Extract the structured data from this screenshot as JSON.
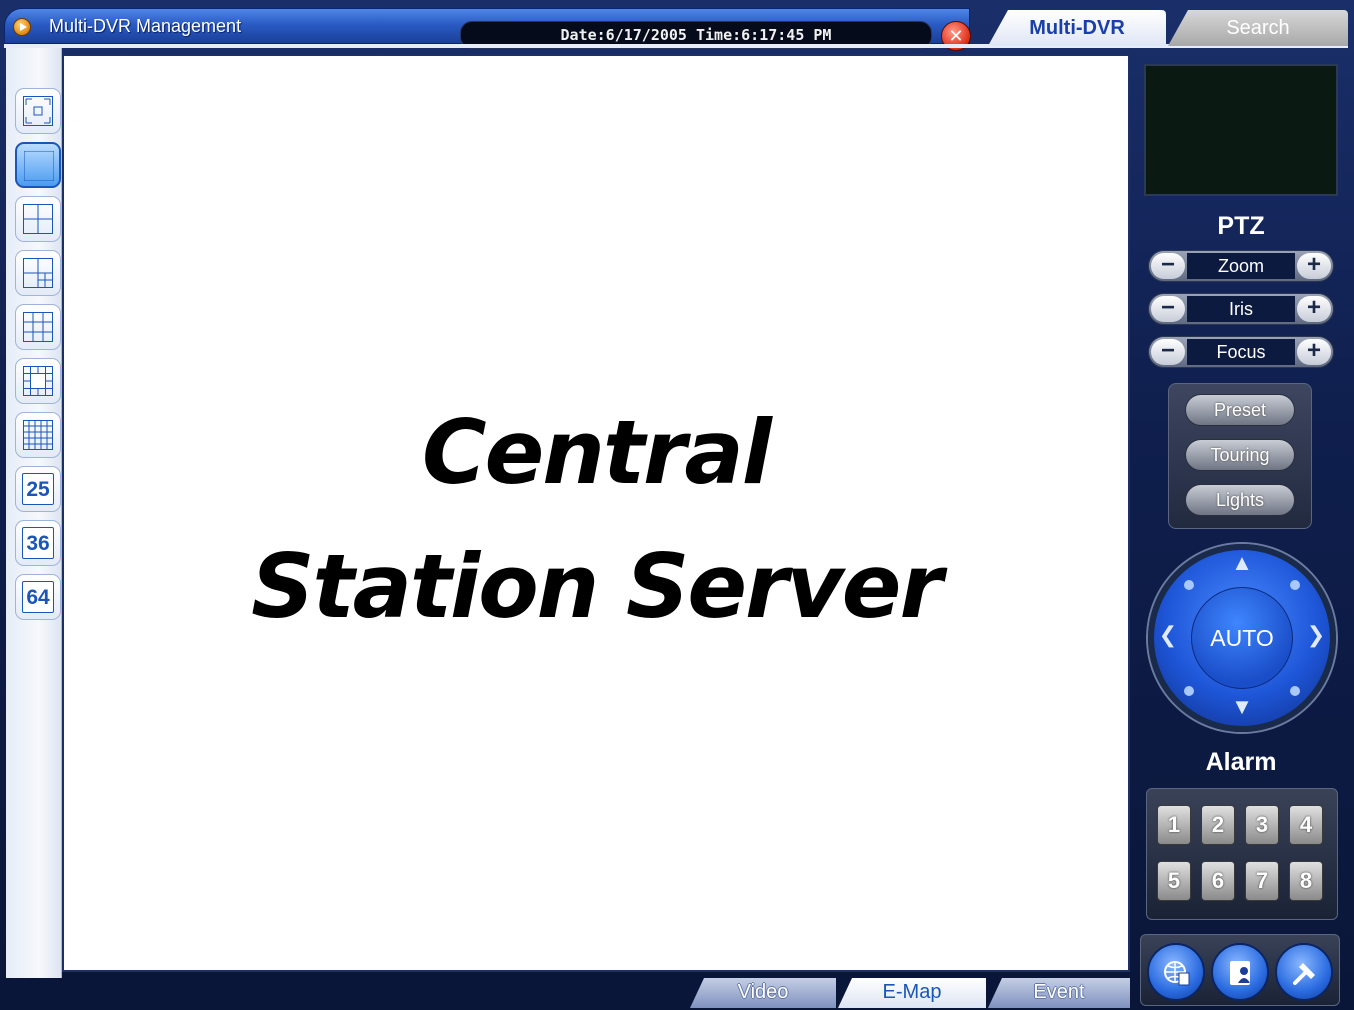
{
  "app": {
    "title": "Multi-DVR Management",
    "datetime": "Date:6/17/2005  Time:6:17:45 PM"
  },
  "tabs": {
    "top": [
      "Multi-DVR",
      "Search"
    ],
    "bottom": [
      "Video",
      "E-Map",
      "Event"
    ]
  },
  "layout_buttons": [
    {
      "name": "fullscreen",
      "icon": "fullscreen-icon"
    },
    {
      "name": "single",
      "icon": "single-view-icon",
      "active": true
    },
    {
      "name": "quad",
      "icon": "grid-2x2-icon"
    },
    {
      "name": "six",
      "icon": "grid-6-icon"
    },
    {
      "name": "nine",
      "icon": "grid-3x3-icon"
    },
    {
      "name": "thirteen",
      "icon": "grid-13-icon"
    },
    {
      "name": "sixteen",
      "icon": "grid-4x4-icon"
    },
    {
      "name": "25",
      "label": "25"
    },
    {
      "name": "36",
      "label": "36"
    },
    {
      "name": "64",
      "label": "64"
    }
  ],
  "main": {
    "banner_line1": "Central",
    "banner_line2": "Station Server"
  },
  "ptz": {
    "title": "PTZ",
    "zoom": "Zoom",
    "iris": "Iris",
    "focus": "Focus",
    "minus": "−",
    "plus": "+",
    "preset": "Preset",
    "touring": "Touring",
    "lights": "Lights",
    "auto": "AUTO"
  },
  "alarm": {
    "title": "Alarm",
    "channels": [
      "1",
      "2",
      "3",
      "4",
      "5",
      "6",
      "7",
      "8"
    ]
  },
  "tools": [
    "network-icon",
    "user-icon",
    "setup-icon"
  ],
  "colors": {
    "accent": "#1a56b8",
    "background": "#0f1f4e"
  }
}
